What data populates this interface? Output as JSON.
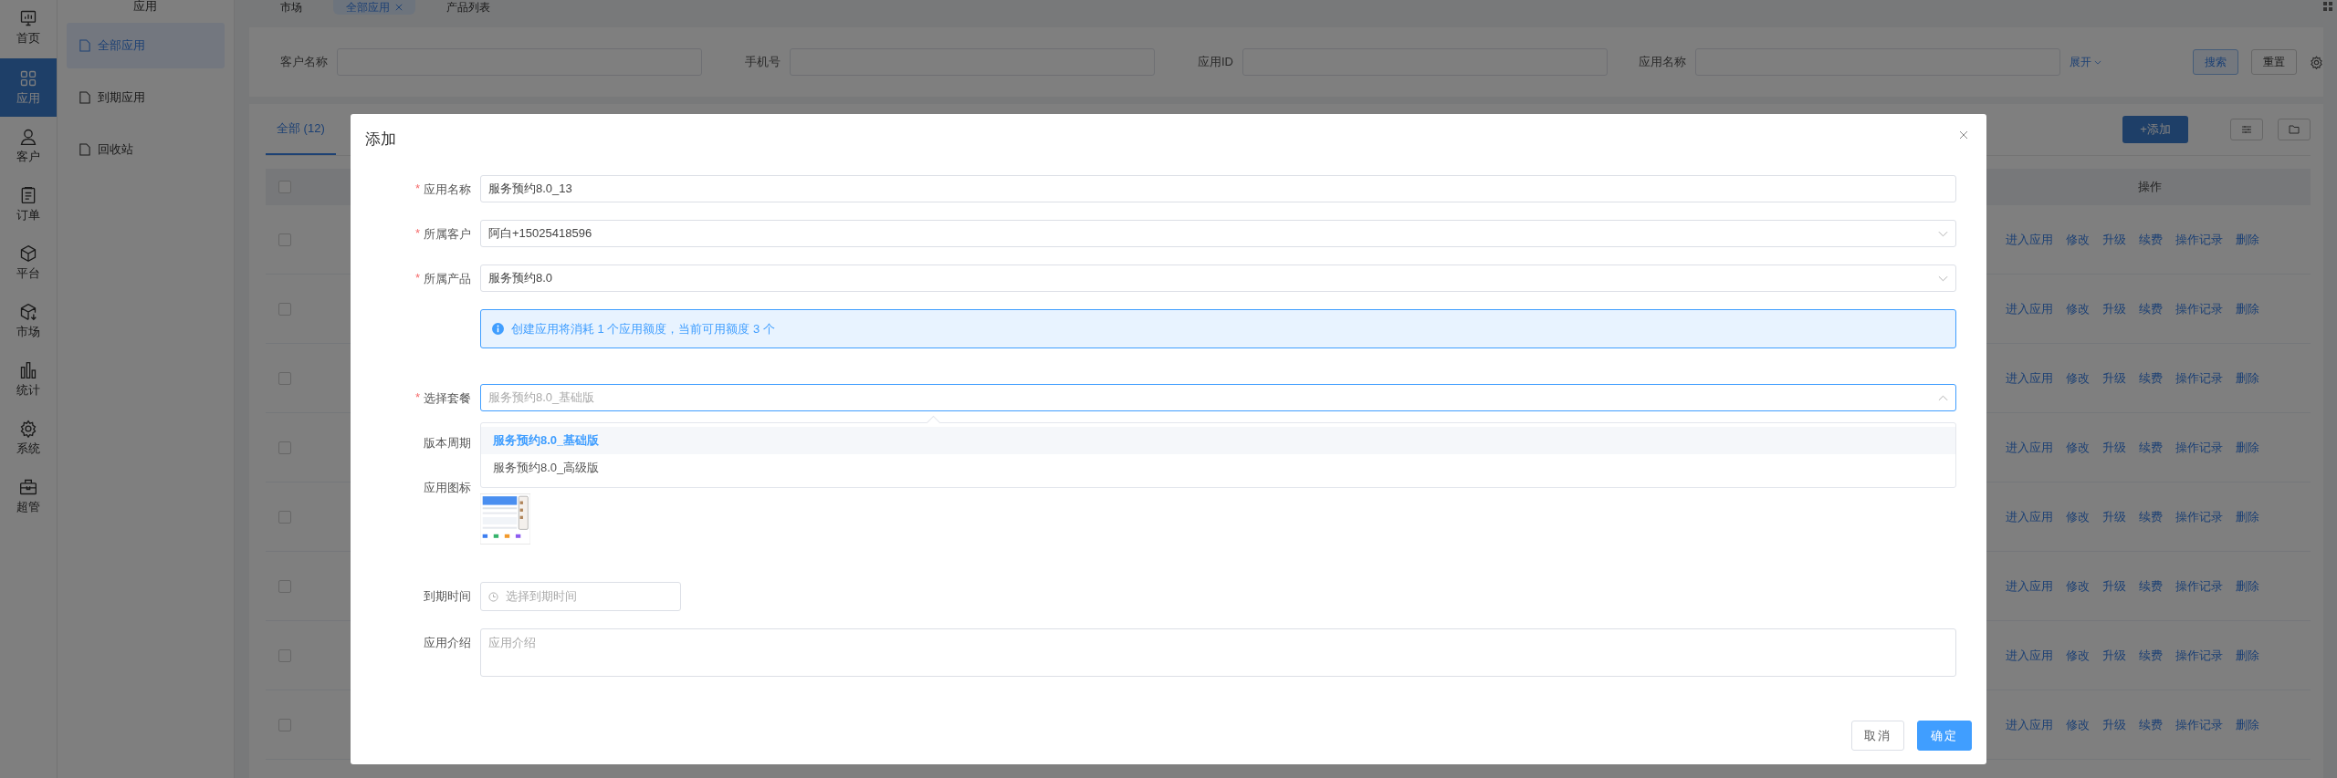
{
  "nav": [
    {
      "label": "首页",
      "kind": "monitor",
      "selected": false
    },
    {
      "label": "应用",
      "kind": "grid",
      "selected": true
    },
    {
      "label": "客户",
      "kind": "person",
      "selected": false
    },
    {
      "label": "订单",
      "kind": "document",
      "selected": false
    },
    {
      "label": "平台",
      "kind": "cube",
      "selected": false
    },
    {
      "label": "市场",
      "kind": "download",
      "selected": false
    },
    {
      "label": "统计",
      "kind": "chart",
      "selected": false
    },
    {
      "label": "系统",
      "kind": "settings",
      "selected": false
    },
    {
      "label": "超管",
      "kind": "toolbox",
      "selected": false
    }
  ],
  "submenu": {
    "title": "应用",
    "items": [
      {
        "label": "全部应用",
        "selected": true
      },
      {
        "label": "到期应用",
        "selected": false
      },
      {
        "label": "回收站",
        "selected": false
      }
    ]
  },
  "page_tabs": [
    {
      "label": "市场",
      "selected": false,
      "closable": false
    },
    {
      "label": "全部应用",
      "selected": true,
      "closable": true
    },
    {
      "label": "产品列表",
      "selected": false,
      "closable": false
    }
  ],
  "filters": [
    {
      "label": "客户名称"
    },
    {
      "label": "手机号"
    },
    {
      "label": "应用ID"
    },
    {
      "label": "应用名称"
    }
  ],
  "expand_link": "展开",
  "search_button": "搜索",
  "reset_button": "重置",
  "list_tabs": [
    {
      "label": "全部",
      "count": "(12)",
      "selected": true
    }
  ],
  "add_button": "+添加",
  "table": {
    "header_checked": false,
    "columns": [
      "操作"
    ],
    "rows": [
      {
        "checked": false,
        "actions": [
          "进入应用",
          "修改",
          "升级",
          "续费",
          "操作记录",
          "删除"
        ]
      },
      {
        "checked": false,
        "actions": [
          "进入应用",
          "修改",
          "升级",
          "续费",
          "操作记录",
          "删除"
        ]
      },
      {
        "checked": false,
        "actions": [
          "进入应用",
          "修改",
          "升级",
          "续费",
          "操作记录",
          "删除"
        ]
      },
      {
        "checked": false,
        "actions": [
          "进入应用",
          "修改",
          "升级",
          "续费",
          "操作记录",
          "删除"
        ]
      },
      {
        "checked": false,
        "actions": [
          "进入应用",
          "修改",
          "升级",
          "续费",
          "操作记录",
          "删除"
        ]
      },
      {
        "checked": false,
        "actions": [
          "进入应用",
          "修改",
          "升级",
          "续费",
          "操作记录",
          "删除"
        ]
      },
      {
        "checked": false,
        "actions": [
          "进入应用",
          "修改",
          "升级",
          "续费",
          "操作记录",
          "删除"
        ]
      },
      {
        "checked": false,
        "actions": [
          "进入应用",
          "修改",
          "升级",
          "续费",
          "操作记录",
          "删除"
        ]
      }
    ]
  },
  "dialog": {
    "title": "添加",
    "fields": [
      {
        "kind": "text",
        "required_mark": "*",
        "label": "应用名称",
        "value": "服务预约8.0_13"
      },
      {
        "kind": "select",
        "required_mark": "*",
        "label": "所属客户",
        "value": "阿白+15025418596"
      },
      {
        "kind": "select",
        "required_mark": "*",
        "label": "所属产品",
        "value": "服务预约8.0"
      },
      {
        "kind": "alert",
        "text": "创建应用将消耗 1 个应用额度，当前可用额度 3 个"
      },
      {
        "kind": "select",
        "required_mark": "*",
        "label": "选择套餐",
        "placeholder": "服务预约8.0_基础版",
        "expanded": true,
        "options": [
          {
            "label": "服务预约8.0_基础版",
            "selected": true
          },
          {
            "label": "服务预约8.0_高级版",
            "selected": false
          }
        ]
      },
      {
        "kind": "blank",
        "label": "版本周期"
      },
      {
        "label": "应用图标"
      },
      {
        "kind": "date",
        "label": "到期时间",
        "placeholder": "选择到期时间"
      },
      {
        "kind": "textarea",
        "label": "应用介绍",
        "placeholder": "应用介绍"
      }
    ],
    "buttons": [
      {
        "label": "取消",
        "primary": false
      },
      {
        "label": "确定",
        "primary": true
      }
    ]
  }
}
